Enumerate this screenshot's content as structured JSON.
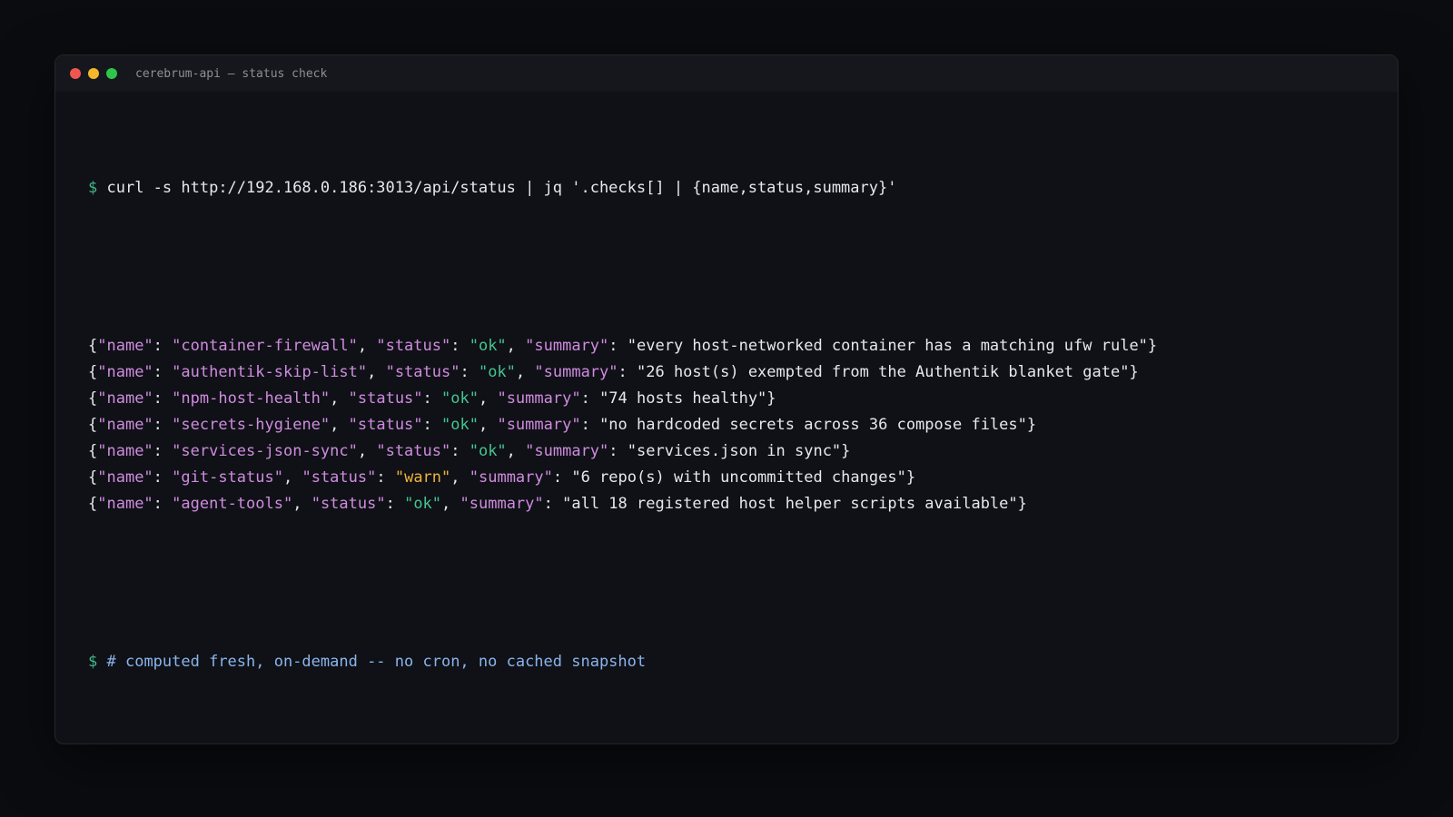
{
  "window": {
    "title": "cerebrum-api — status check",
    "controls": {
      "close_color": "#f0564f",
      "minimize_color": "#f3b82c",
      "maximize_color": "#2fc44a"
    }
  },
  "terminal": {
    "prompt": "$",
    "command": "curl -s http://192.168.0.186:3013/api/status | jq '.checks[] | {name,status,summary}'",
    "rows": [
      {
        "name": "container-firewall",
        "status": "ok",
        "summary": "every host-networked container has a matching ufw rule"
      },
      {
        "name": "authentik-skip-list",
        "status": "ok",
        "summary": "26 host(s) exempted from the Authentik blanket gate"
      },
      {
        "name": "npm-host-health",
        "status": "ok",
        "summary": "74 hosts healthy"
      },
      {
        "name": "secrets-hygiene",
        "status": "ok",
        "summary": "no hardcoded secrets across 36 compose files"
      },
      {
        "name": "services-json-sync",
        "status": "ok",
        "summary": "services.json in sync"
      },
      {
        "name": "git-status",
        "status": "warn",
        "summary": "6 repo(s) with uncommitted changes"
      },
      {
        "name": "agent-tools",
        "status": "ok",
        "summary": "all 18 registered host helper scripts available"
      }
    ],
    "json_keys": {
      "name": "\"name\"",
      "status": "\"status\"",
      "summary": "\"summary\""
    },
    "comment": "# computed fresh, on-demand -- no cron, no cached snapshot"
  },
  "colors": {
    "background": "#0a0c10",
    "terminal_bg": "#0f1116",
    "prompt": "#3fb98a",
    "key": "#d08be0",
    "ok": "#45c48f",
    "warn": "#f0b43c",
    "comment": "#8ab4ec"
  }
}
